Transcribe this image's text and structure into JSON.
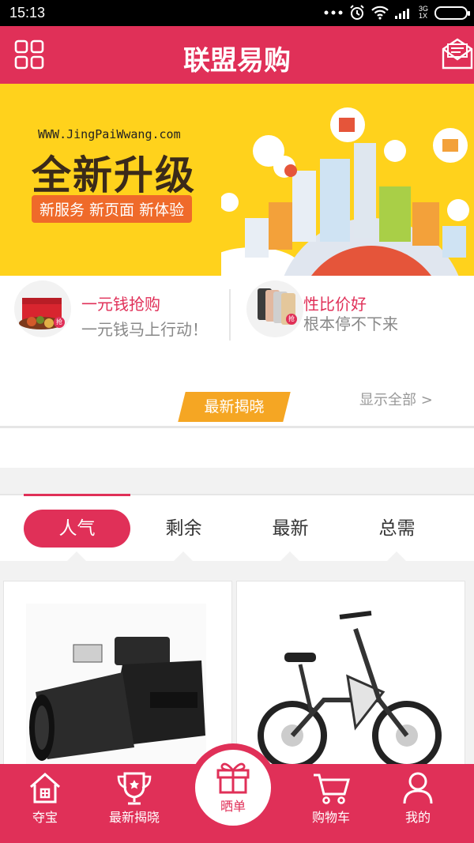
{
  "status_bar": {
    "time": "15:13",
    "network": "3G",
    "network_sub": "1X"
  },
  "header": {
    "title": "联盟易购"
  },
  "banner": {
    "url": "WWW.JingPaiWwang.com",
    "headline": "全新升级",
    "subline": "新服务 新页面 新体验"
  },
  "promos": [
    {
      "name": "一元钱抢购",
      "desc": "一元钱马上行动！",
      "badge": "抢"
    },
    {
      "name": "性比价好",
      "desc": "根本停不下来",
      "badge": "抢"
    }
  ],
  "latest_reveal": {
    "label": "最新揭晓",
    "show_all": "显示全部 >"
  },
  "tabs": [
    {
      "label": "人气",
      "active": true
    },
    {
      "label": "剩余",
      "active": false
    },
    {
      "label": "最新",
      "active": false
    },
    {
      "label": "总需",
      "active": false
    }
  ],
  "bottom_nav": [
    {
      "label": "夺宝",
      "icon": "home-icon"
    },
    {
      "label": "最新揭晓",
      "icon": "trophy-icon"
    },
    {
      "label": "晒单",
      "icon": "gift-icon"
    },
    {
      "label": "购物车",
      "icon": "cart-icon"
    },
    {
      "label": "我的",
      "icon": "user-icon"
    }
  ],
  "colors": {
    "primary": "#e03058",
    "banner_bg": "#ffd21c",
    "accent_orange": "#f5a623"
  }
}
